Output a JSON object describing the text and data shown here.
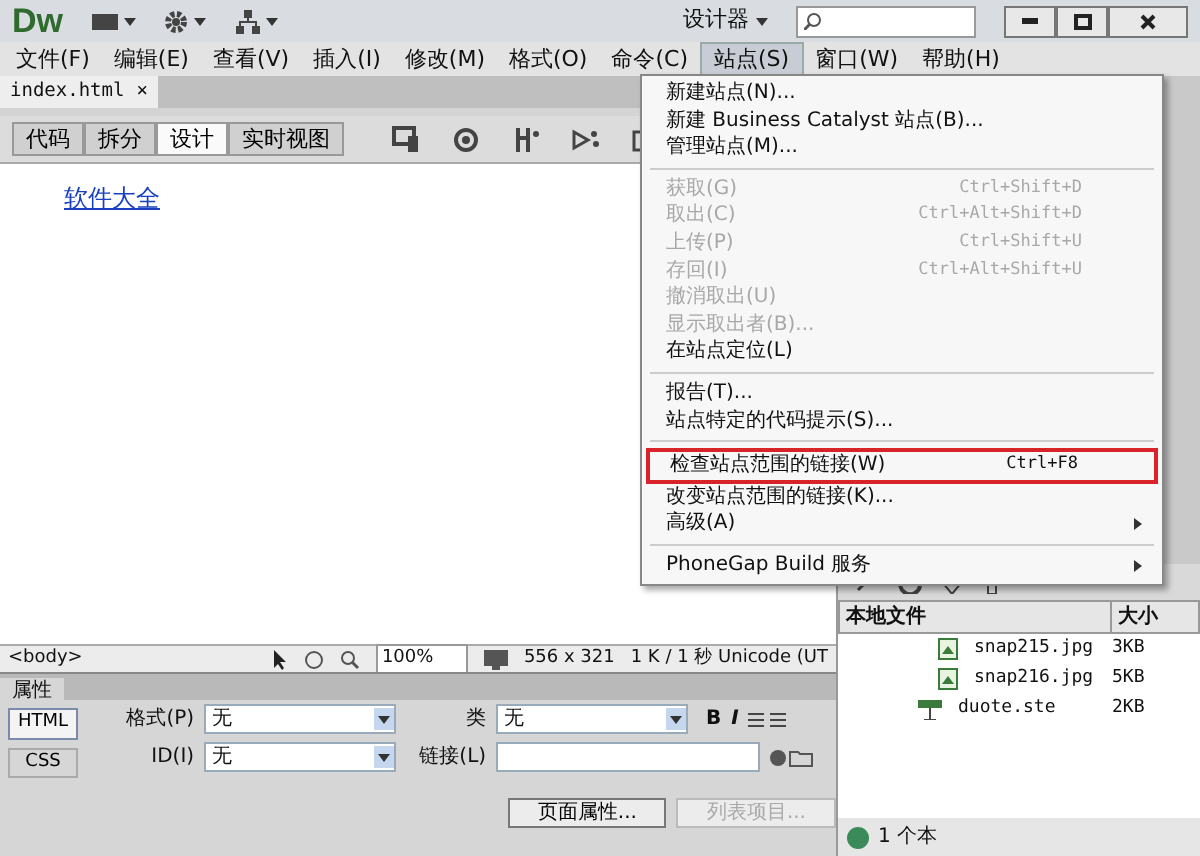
{
  "title_bar": {
    "logo": "Dw",
    "workspace": "设计器"
  },
  "menu_bar": [
    {
      "label": "文件(F)",
      "selected": false
    },
    {
      "label": "编辑(E)",
      "selected": false
    },
    {
      "label": "查看(V)",
      "selected": false
    },
    {
      "label": "插入(I)",
      "selected": false
    },
    {
      "label": "修改(M)",
      "selected": false
    },
    {
      "label": "格式(O)",
      "selected": false
    },
    {
      "label": "命令(C)",
      "selected": false
    },
    {
      "label": "站点(S)",
      "selected": true
    },
    {
      "label": "窗口(W)",
      "selected": false
    },
    {
      "label": "帮助(H)",
      "selected": false
    }
  ],
  "document_tabs": [
    {
      "label": "index.html",
      "close": "×",
      "selected": true
    }
  ],
  "view_buttons": [
    {
      "label": "代码",
      "selected": false
    },
    {
      "label": "拆分",
      "selected": false
    },
    {
      "label": "设计",
      "selected": true
    },
    {
      "label": "实时视图",
      "selected": false
    }
  ],
  "design": {
    "link": "软件大全"
  },
  "status_bar": {
    "tag": "<body>",
    "zoom": "100%",
    "size": "556 x 321",
    "info": "1 K / 1 秒 Unicode (UT"
  },
  "properties": {
    "title": "属性",
    "modes": [
      {
        "label": "HTML",
        "selected": true
      },
      {
        "label": "CSS",
        "selected": false
      }
    ],
    "format_label": "格式(P)",
    "format_value": "无",
    "id_label": "ID(I)",
    "id_value": "无",
    "class_label": "类",
    "class_value": "无",
    "link_label": "链接(L)",
    "bold": "B",
    "italic": "I",
    "page_properties": "页面属性...",
    "list_item": {
      "label": "列表项目...",
      "disabled": true
    }
  },
  "files_panel": {
    "columns": [
      "本地文件",
      "大小"
    ],
    "rows": [
      {
        "name": "snap215.jpg",
        "size": "3KB",
        "kind": "image"
      },
      {
        "name": "snap216.jpg",
        "size": "5KB",
        "kind": "image"
      },
      {
        "name": "duote.ste",
        "size": "2KB",
        "kind": "site"
      }
    ],
    "status": "1 个本"
  },
  "site_menu": [
    {
      "kind": "item",
      "label": "新建站点(N)...",
      "disabled": false
    },
    {
      "kind": "item",
      "label": "新建 Business Catalyst 站点(B)...",
      "disabled": false
    },
    {
      "kind": "item",
      "label": "管理站点(M)...",
      "disabled": false
    },
    {
      "kind": "separator"
    },
    {
      "kind": "item",
      "label": "获取(G)",
      "shortcut": "Ctrl+Shift+D",
      "disabled": true
    },
    {
      "kind": "item",
      "label": "取出(C)",
      "shortcut": "Ctrl+Alt+Shift+D",
      "disabled": true
    },
    {
      "kind": "item",
      "label": "上传(P)",
      "shortcut": "Ctrl+Shift+U",
      "disabled": true
    },
    {
      "kind": "item",
      "label": "存回(I)",
      "shortcut": "Ctrl+Alt+Shift+U",
      "disabled": true
    },
    {
      "kind": "item",
      "label": "撤消取出(U)",
      "disabled": true
    },
    {
      "kind": "item",
      "label": "显示取出者(B)...",
      "disabled": true
    },
    {
      "kind": "item",
      "label": "在站点定位(L)",
      "disabled": false
    },
    {
      "kind": "separator"
    },
    {
      "kind": "item",
      "label": "报告(T)...",
      "disabled": false
    },
    {
      "kind": "item",
      "label": "站点特定的代码提示(S)...",
      "disabled": false
    },
    {
      "kind": "separator"
    },
    {
      "kind": "item",
      "label": "检查站点范围的链接(W)",
      "shortcut": "Ctrl+F8",
      "disabled": false,
      "highlighted": true
    },
    {
      "kind": "item",
      "label": "改变站点范围的链接(K)...",
      "disabled": false
    },
    {
      "kind": "item",
      "label": "高级(A)",
      "disabled": false,
      "submenu": true
    },
    {
      "kind": "separator"
    },
    {
      "kind": "item",
      "label": "PhoneGap Build 服务",
      "disabled": false,
      "submenu": true
    }
  ]
}
